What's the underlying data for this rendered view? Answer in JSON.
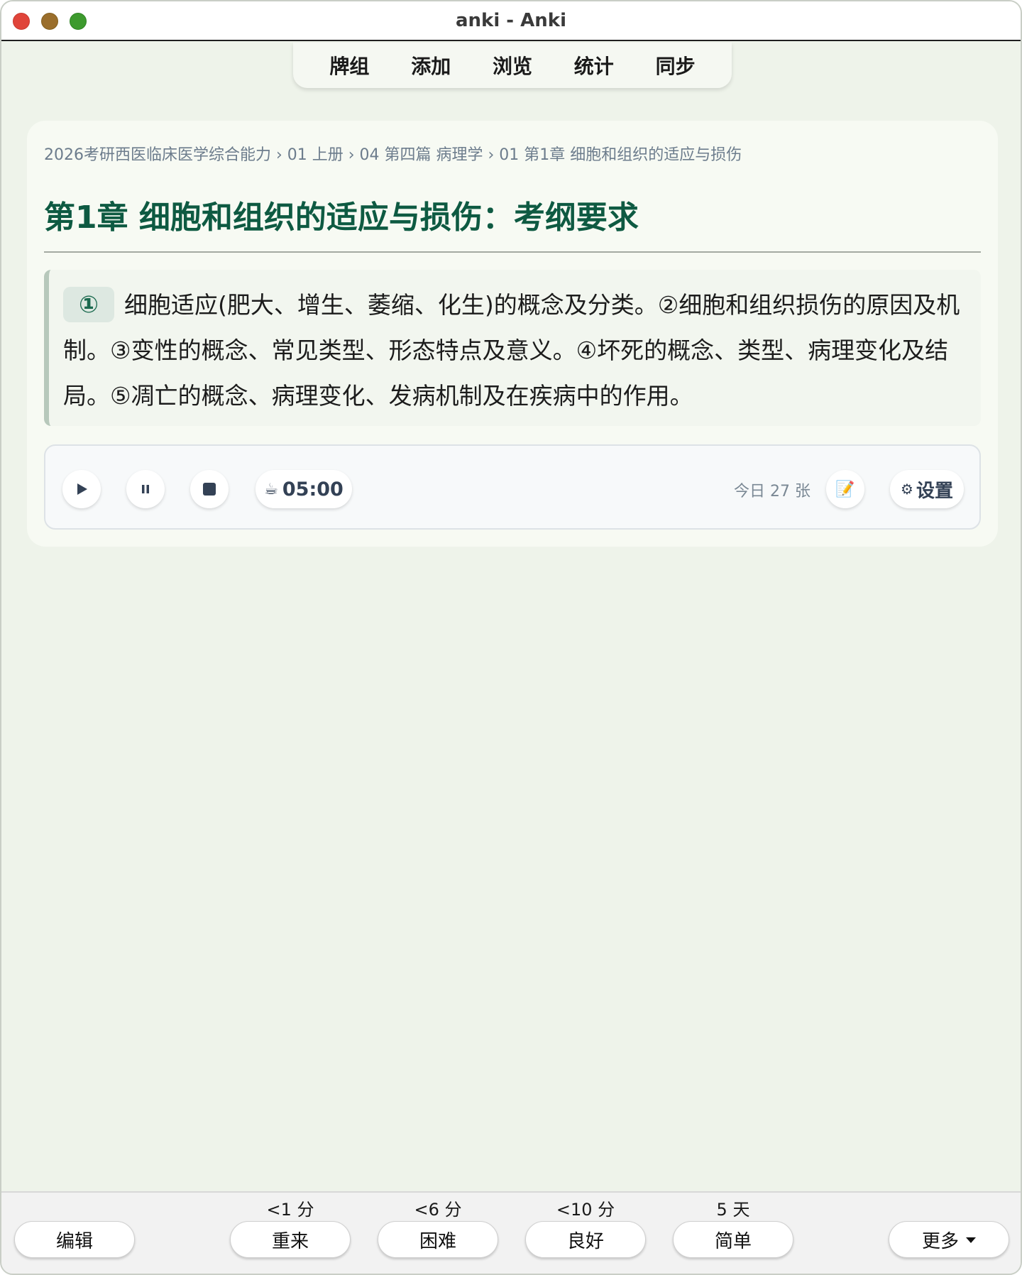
{
  "window": {
    "title": "anki - Anki"
  },
  "topnav": {
    "items": [
      {
        "label": "牌组"
      },
      {
        "label": "添加"
      },
      {
        "label": "浏览"
      },
      {
        "label": "统计"
      },
      {
        "label": "同步"
      }
    ]
  },
  "card": {
    "breadcrumb": "2026考研西医临床医学综合能力 › 01 上册 › 04 第四篇 病理学 › 01 第1章 细胞和组织的适应与损伤",
    "title": "第1章 细胞和组织的适应与损伤：考纲要求",
    "badge": "①",
    "syllabus_text": "细胞适应(肥大、增生、萎缩、化生)的概念及分类。②细胞和组织损伤的原因及机制。③变性的概念、常见类型、形态特点及意义。④坏死的概念、类型、病理变化及结局。⑤凋亡的概念、病理变化、发病机制及在疾病中的作用。"
  },
  "player": {
    "timer_icon": "☕",
    "timer": "05:00",
    "today": "今日 27 张",
    "note_icon": "📝",
    "settings_icon": "⚙",
    "settings_label": "设置"
  },
  "bottombar": {
    "edit_label": "编辑",
    "more_label": "更多",
    "answers": [
      {
        "interval": "<1 分",
        "label": "重来"
      },
      {
        "interval": "<6 分",
        "label": "困难"
      },
      {
        "interval": "<10 分",
        "label": "良好"
      },
      {
        "interval": "5 天",
        "label": "简单"
      }
    ]
  }
}
